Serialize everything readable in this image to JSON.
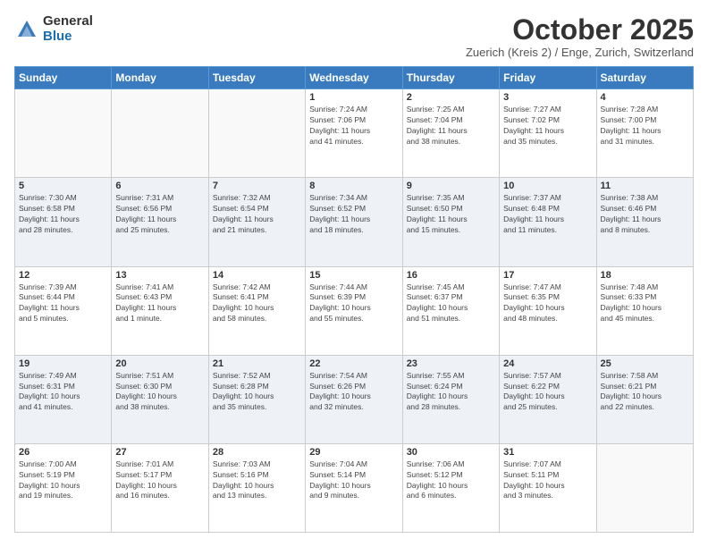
{
  "logo": {
    "general": "General",
    "blue": "Blue"
  },
  "header": {
    "month": "October 2025",
    "location": "Zuerich (Kreis 2) / Enge, Zurich, Switzerland"
  },
  "weekdays": [
    "Sunday",
    "Monday",
    "Tuesday",
    "Wednesday",
    "Thursday",
    "Friday",
    "Saturday"
  ],
  "weeks": [
    [
      {
        "day": "",
        "info": ""
      },
      {
        "day": "",
        "info": ""
      },
      {
        "day": "",
        "info": ""
      },
      {
        "day": "1",
        "info": "Sunrise: 7:24 AM\nSunset: 7:06 PM\nDaylight: 11 hours\nand 41 minutes."
      },
      {
        "day": "2",
        "info": "Sunrise: 7:25 AM\nSunset: 7:04 PM\nDaylight: 11 hours\nand 38 minutes."
      },
      {
        "day": "3",
        "info": "Sunrise: 7:27 AM\nSunset: 7:02 PM\nDaylight: 11 hours\nand 35 minutes."
      },
      {
        "day": "4",
        "info": "Sunrise: 7:28 AM\nSunset: 7:00 PM\nDaylight: 11 hours\nand 31 minutes."
      }
    ],
    [
      {
        "day": "5",
        "info": "Sunrise: 7:30 AM\nSunset: 6:58 PM\nDaylight: 11 hours\nand 28 minutes."
      },
      {
        "day": "6",
        "info": "Sunrise: 7:31 AM\nSunset: 6:56 PM\nDaylight: 11 hours\nand 25 minutes."
      },
      {
        "day": "7",
        "info": "Sunrise: 7:32 AM\nSunset: 6:54 PM\nDaylight: 11 hours\nand 21 minutes."
      },
      {
        "day": "8",
        "info": "Sunrise: 7:34 AM\nSunset: 6:52 PM\nDaylight: 11 hours\nand 18 minutes."
      },
      {
        "day": "9",
        "info": "Sunrise: 7:35 AM\nSunset: 6:50 PM\nDaylight: 11 hours\nand 15 minutes."
      },
      {
        "day": "10",
        "info": "Sunrise: 7:37 AM\nSunset: 6:48 PM\nDaylight: 11 hours\nand 11 minutes."
      },
      {
        "day": "11",
        "info": "Sunrise: 7:38 AM\nSunset: 6:46 PM\nDaylight: 11 hours\nand 8 minutes."
      }
    ],
    [
      {
        "day": "12",
        "info": "Sunrise: 7:39 AM\nSunset: 6:44 PM\nDaylight: 11 hours\nand 5 minutes."
      },
      {
        "day": "13",
        "info": "Sunrise: 7:41 AM\nSunset: 6:43 PM\nDaylight: 11 hours\nand 1 minute."
      },
      {
        "day": "14",
        "info": "Sunrise: 7:42 AM\nSunset: 6:41 PM\nDaylight: 10 hours\nand 58 minutes."
      },
      {
        "day": "15",
        "info": "Sunrise: 7:44 AM\nSunset: 6:39 PM\nDaylight: 10 hours\nand 55 minutes."
      },
      {
        "day": "16",
        "info": "Sunrise: 7:45 AM\nSunset: 6:37 PM\nDaylight: 10 hours\nand 51 minutes."
      },
      {
        "day": "17",
        "info": "Sunrise: 7:47 AM\nSunset: 6:35 PM\nDaylight: 10 hours\nand 48 minutes."
      },
      {
        "day": "18",
        "info": "Sunrise: 7:48 AM\nSunset: 6:33 PM\nDaylight: 10 hours\nand 45 minutes."
      }
    ],
    [
      {
        "day": "19",
        "info": "Sunrise: 7:49 AM\nSunset: 6:31 PM\nDaylight: 10 hours\nand 41 minutes."
      },
      {
        "day": "20",
        "info": "Sunrise: 7:51 AM\nSunset: 6:30 PM\nDaylight: 10 hours\nand 38 minutes."
      },
      {
        "day": "21",
        "info": "Sunrise: 7:52 AM\nSunset: 6:28 PM\nDaylight: 10 hours\nand 35 minutes."
      },
      {
        "day": "22",
        "info": "Sunrise: 7:54 AM\nSunset: 6:26 PM\nDaylight: 10 hours\nand 32 minutes."
      },
      {
        "day": "23",
        "info": "Sunrise: 7:55 AM\nSunset: 6:24 PM\nDaylight: 10 hours\nand 28 minutes."
      },
      {
        "day": "24",
        "info": "Sunrise: 7:57 AM\nSunset: 6:22 PM\nDaylight: 10 hours\nand 25 minutes."
      },
      {
        "day": "25",
        "info": "Sunrise: 7:58 AM\nSunset: 6:21 PM\nDaylight: 10 hours\nand 22 minutes."
      }
    ],
    [
      {
        "day": "26",
        "info": "Sunrise: 7:00 AM\nSunset: 5:19 PM\nDaylight: 10 hours\nand 19 minutes."
      },
      {
        "day": "27",
        "info": "Sunrise: 7:01 AM\nSunset: 5:17 PM\nDaylight: 10 hours\nand 16 minutes."
      },
      {
        "day": "28",
        "info": "Sunrise: 7:03 AM\nSunset: 5:16 PM\nDaylight: 10 hours\nand 13 minutes."
      },
      {
        "day": "29",
        "info": "Sunrise: 7:04 AM\nSunset: 5:14 PM\nDaylight: 10 hours\nand 9 minutes."
      },
      {
        "day": "30",
        "info": "Sunrise: 7:06 AM\nSunset: 5:12 PM\nDaylight: 10 hours\nand 6 minutes."
      },
      {
        "day": "31",
        "info": "Sunrise: 7:07 AM\nSunset: 5:11 PM\nDaylight: 10 hours\nand 3 minutes."
      },
      {
        "day": "",
        "info": ""
      }
    ]
  ]
}
